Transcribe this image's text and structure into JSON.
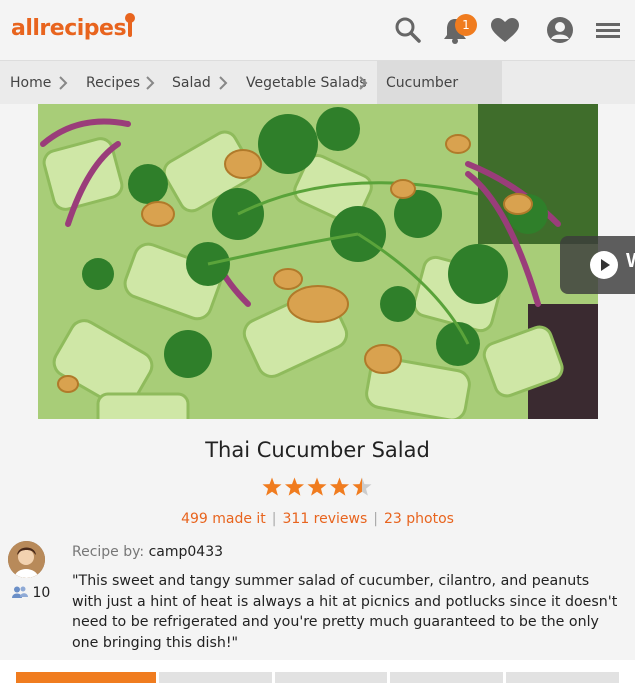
{
  "header": {
    "logo_text": "allrecipes",
    "notification_count": "1",
    "icons": [
      "search-icon",
      "bell-icon",
      "heart-icon",
      "profile-icon",
      "menu-icon"
    ],
    "accent_color": "#f07c1f"
  },
  "breadcrumb": {
    "items": [
      "Home",
      "Recipes",
      "Salad",
      "Vegetable Salads",
      "Cucumber Salad"
    ]
  },
  "hero": {
    "video_button_label": "W"
  },
  "recipe": {
    "title": "Thai Cucumber Salad",
    "rating": 4.5,
    "made_it": "499 made it",
    "reviews": "311 reviews",
    "photos": "23 photos",
    "recipe_by_label": "Recipe by:",
    "author": "camp0433",
    "followers": "10",
    "description": "\"This sweet and tangy summer salad of cucumber, cilantro, and peanuts with just a hint of heat is always a hit at picnics and potlucks since it doesn't need to be refrigerated and you're pretty much guaranteed to be the only one bringing this dish!\""
  }
}
